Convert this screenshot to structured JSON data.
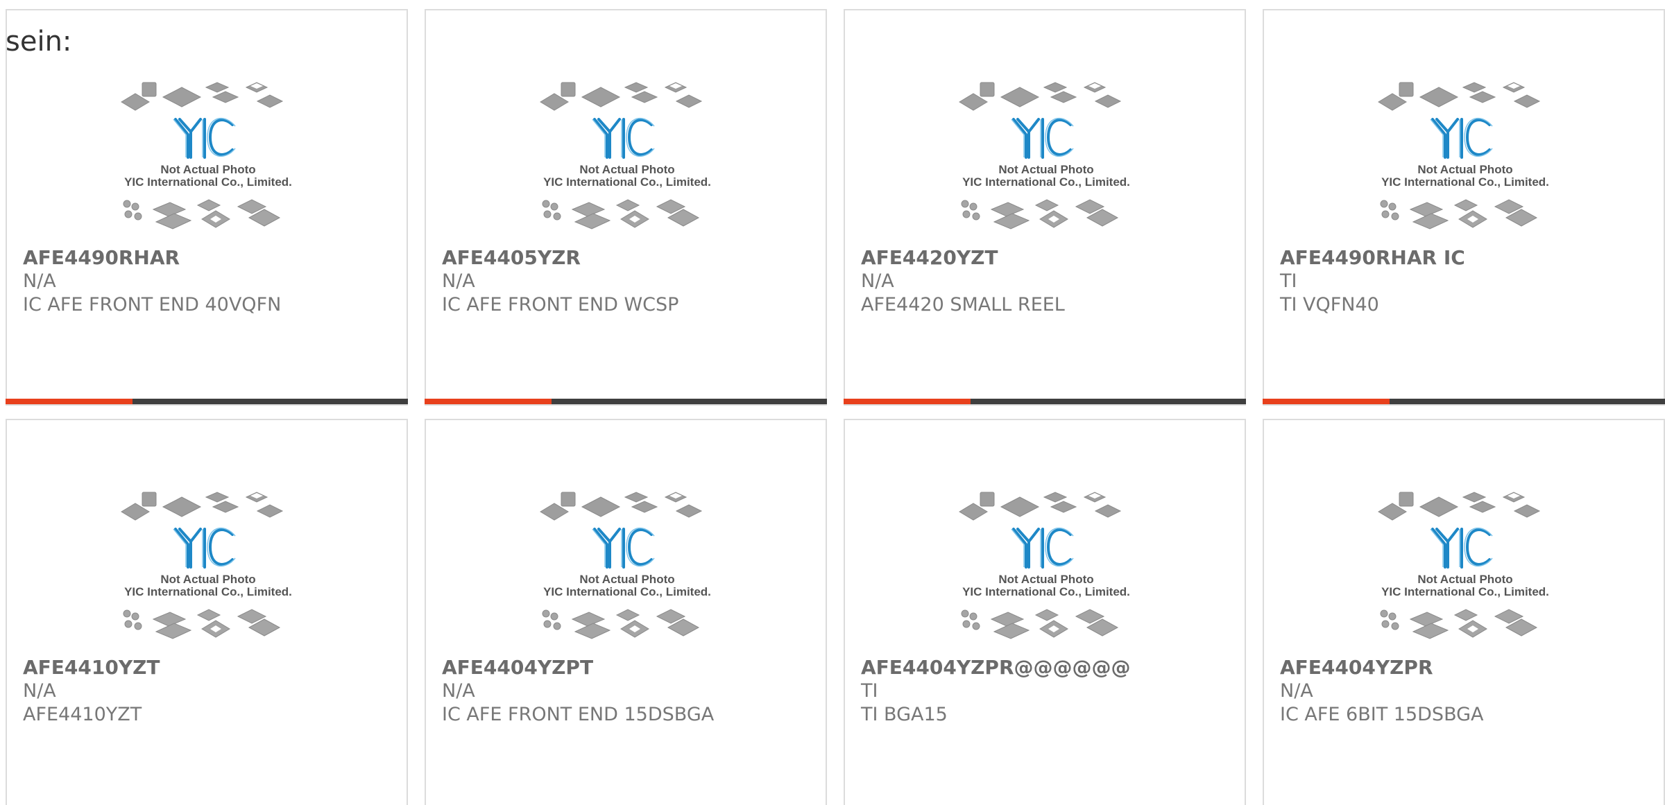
{
  "lead_text": "sein:",
  "placeholder_image": {
    "brand": "YIC",
    "line1": "Not Actual Photo",
    "line2": "YIC International Co., Limited."
  },
  "colors": {
    "accent": "#e8401c",
    "bar": "#3f3f3f",
    "logo_blue": "#1e88c7"
  },
  "products": [
    {
      "part": "AFE4490RHAR",
      "maker": "N/A",
      "desc": "IC AFE FRONT END 40VQFN"
    },
    {
      "part": "AFE4405YZR",
      "maker": "N/A",
      "desc": "IC AFE FRONT END WCSP"
    },
    {
      "part": "AFE4420YZT",
      "maker": "N/A",
      "desc": "AFE4420 SMALL REEL"
    },
    {
      "part": "AFE4490RHAR IC",
      "maker": "TI",
      "desc": "TI VQFN40"
    },
    {
      "part": "AFE4410YZT",
      "maker": "N/A",
      "desc": "AFE4410YZT"
    },
    {
      "part": "AFE4404YZPT",
      "maker": "N/A",
      "desc": "IC AFE FRONT END 15DSBGA"
    },
    {
      "part": "AFE4404YZPR@@@@@@",
      "maker": "TI",
      "desc": "TI BGA15"
    },
    {
      "part": "AFE4404YZPR",
      "maker": "N/A",
      "desc": "IC AFE 6BIT 15DSBGA"
    }
  ]
}
